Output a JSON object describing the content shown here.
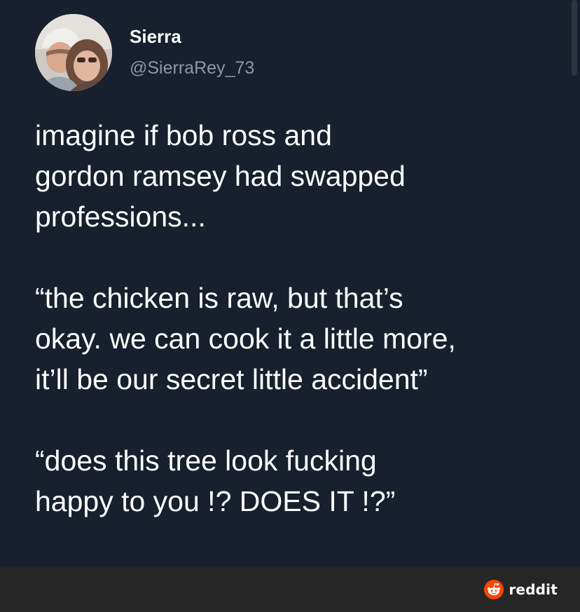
{
  "tweet": {
    "author": {
      "display_name": "Sierra",
      "handle": "@SierraRey_73"
    },
    "body": {
      "paragraph_1": "imagine if bob ross and\ngordon ramsey had swapped\nprofessions...",
      "paragraph_2": "“the chicken is raw, but that’s\nokay. we can cook it a little more,\nit’ll be our secret little accident”",
      "paragraph_3": "“does this tree look fucking\nhappy to you !? DOES IT !?”"
    }
  },
  "watermark": {
    "brand_text": "reddit",
    "brand_color": "#ff4500"
  },
  "colors": {
    "background": "#17202c",
    "text_primary": "#ffffff",
    "text_secondary": "#8b98a5",
    "footer_bar": "#262626"
  },
  "icons": {
    "avatar": "profile-photo",
    "brand": "reddit-logo-icon"
  }
}
